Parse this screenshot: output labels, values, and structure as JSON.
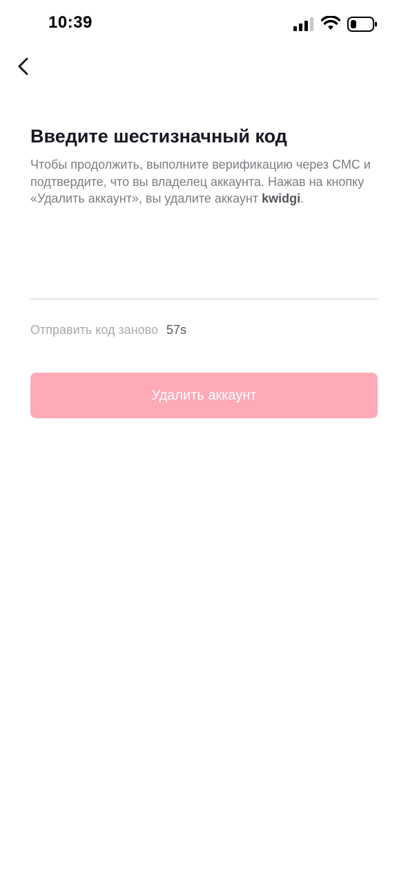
{
  "status_bar": {
    "time": "10:39",
    "icons": [
      "cellular-signal-icon",
      "wifi-icon",
      "battery-icon"
    ]
  },
  "nav": {
    "back_icon": "chevron-left-icon"
  },
  "main": {
    "title": "Введите шестизначный код",
    "description_prefix": "Чтобы продолжить, выполните верификацию через СМС и подтвердите, что вы владелец аккаунта. Нажав на кнопку «Удалить аккаунт», вы удалите аккаунт ",
    "username": "kwidgi",
    "description_suffix": ".",
    "code_value": "",
    "resend_label": "Отправить код заново",
    "resend_timer": "57s",
    "delete_button_label": "Удалить аккаунт"
  },
  "colors": {
    "button_disabled_bg": "#feaab7",
    "button_text": "#ffffff",
    "title_text": "#161823",
    "secondary_text": "#7c7d83",
    "muted_text": "#a9aaae"
  }
}
